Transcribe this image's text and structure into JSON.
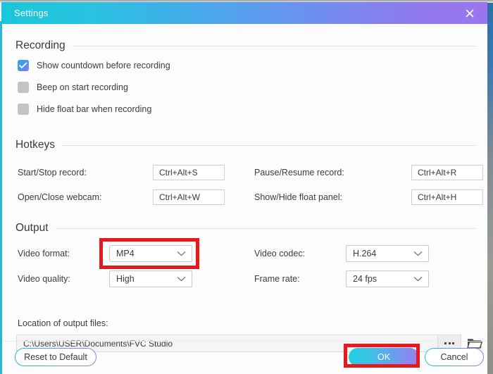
{
  "window": {
    "title": "Settings",
    "close_icon": "close-icon",
    "titlebar_gradient_from": "#18c8d8",
    "titlebar_gradient_to": "#9b74ef"
  },
  "sections": {
    "recording": {
      "title": "Recording",
      "checkboxes": [
        {
          "label": "Show countdown before recording",
          "checked": true
        },
        {
          "label": "Beep on start recording",
          "checked": false
        },
        {
          "label": "Hide float bar when recording",
          "checked": false
        }
      ]
    },
    "hotkeys": {
      "title": "Hotkeys",
      "items": [
        {
          "label": "Start/Stop record:",
          "value": "Ctrl+Alt+S"
        },
        {
          "label": "Pause/Resume record:",
          "value": "Ctrl+Alt+R"
        },
        {
          "label": "Open/Close webcam:",
          "value": "Ctrl+Alt+W"
        },
        {
          "label": "Show/Hide float panel:",
          "value": "Ctrl+Alt+H"
        }
      ]
    },
    "output": {
      "title": "Output",
      "video_format": {
        "label": "Video format:",
        "value": "MP4"
      },
      "video_codec": {
        "label": "Video codec:",
        "value": "H.264"
      },
      "video_quality": {
        "label": "Video quality:",
        "value": "High"
      },
      "frame_rate": {
        "label": "Frame rate:",
        "value": "24 fps"
      },
      "location": {
        "label": "Location of output files:",
        "path": "C:\\Users\\USER\\Documents\\FVC Studio",
        "browse_icon": "ellipsis-icon",
        "folder_icon": "folder-icon"
      }
    }
  },
  "footer": {
    "reset_label": "Reset to Default",
    "ok_label": "OK",
    "cancel_label": "Cancel",
    "ok_gradient_from": "#1fd0e0",
    "ok_gradient_to": "#9a7bef"
  },
  "annotations": {
    "highlight_color": "#e8191c",
    "boxes": [
      "video-format-dropdown",
      "ok-button"
    ]
  }
}
